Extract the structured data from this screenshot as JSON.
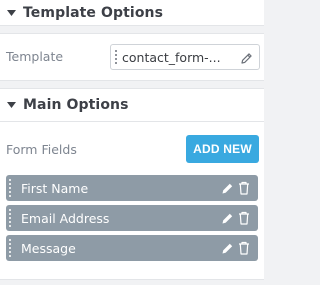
{
  "template_options": {
    "title": "Template Options",
    "template_label": "Template",
    "template_value": "contact_form-..."
  },
  "main_options": {
    "title": "Main Options",
    "form_fields_label": "Form Fields",
    "add_new_label": "ADD NEW",
    "fields": [
      {
        "label": "First Name"
      },
      {
        "label": "Email Address"
      },
      {
        "label": "Message"
      }
    ]
  },
  "colors": {
    "accent": "#39a9e0",
    "row_bg": "#8e9ba6"
  }
}
